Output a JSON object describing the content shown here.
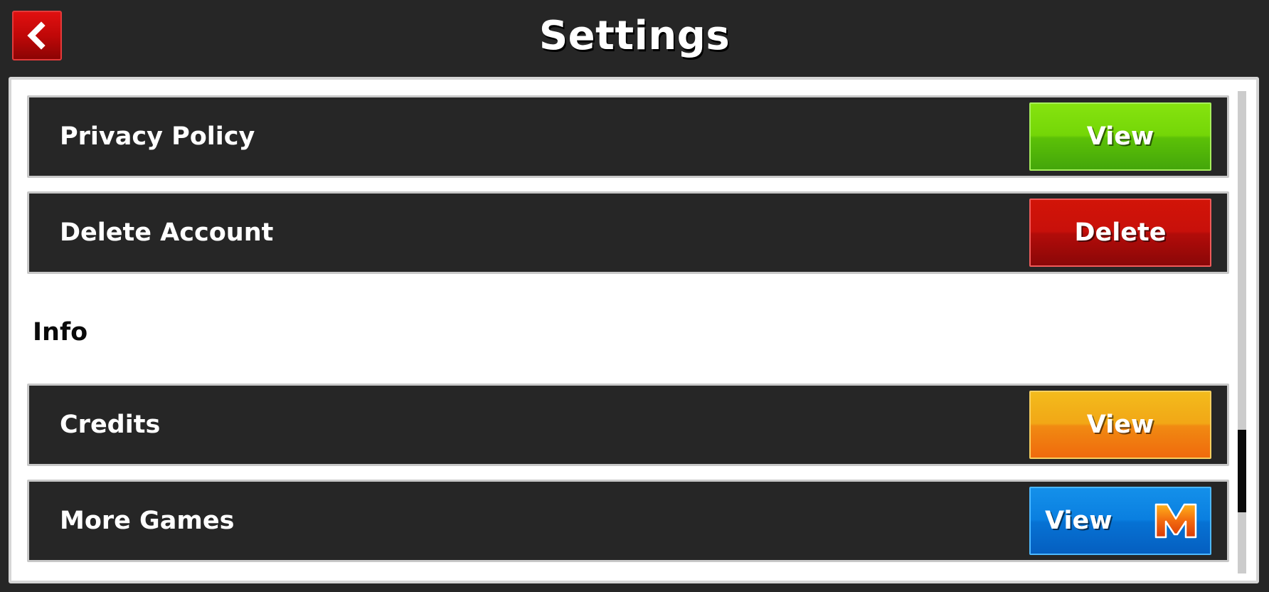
{
  "header": {
    "title": "Settings",
    "back_icon": "chevron-left-icon"
  },
  "rows_top": [
    {
      "label": "Privacy Policy",
      "button": "View",
      "color": "#74d607"
    },
    {
      "label": "Delete Account",
      "button": "Delete",
      "color": "#c8100a"
    }
  ],
  "section": {
    "title": "Info"
  },
  "rows_info": [
    {
      "label": "Credits",
      "button": "View",
      "color": "#f2a716"
    },
    {
      "label": "More Games",
      "button": "View",
      "color": "#0a7fe0",
      "icon": "m-logo-icon"
    }
  ],
  "colors": {
    "background": "#262626",
    "panel": "#ffffff",
    "back_button": "#c00808"
  }
}
